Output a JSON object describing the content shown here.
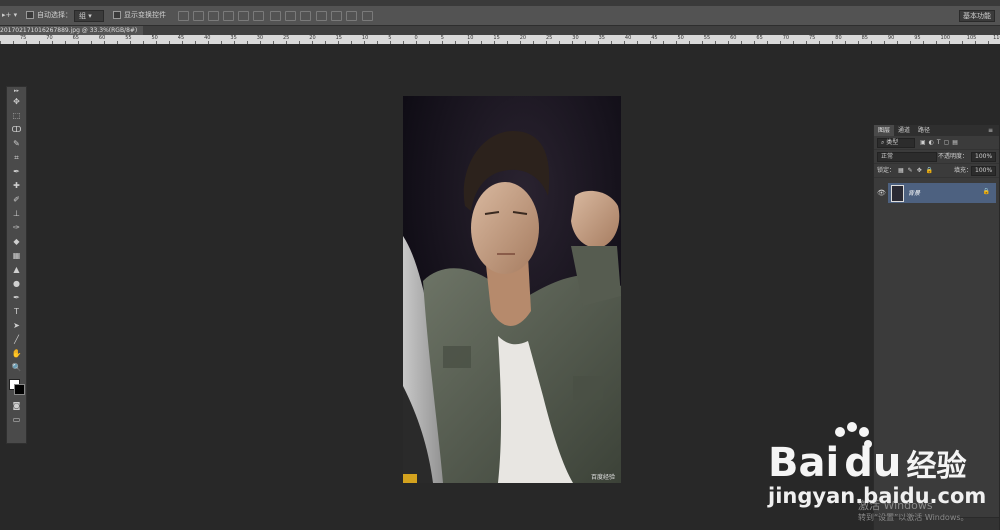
{
  "menu": {
    "items": [
      "",
      "",
      "",
      "",
      "",
      "",
      "",
      "",
      "",
      "",
      ""
    ]
  },
  "options": {
    "auto_select_label": "自动选择：",
    "auto_select_value": "组",
    "show_transform_label": "显示变换控件",
    "workspace_label": "基本功能"
  },
  "document": {
    "tab_label": "201702171016267889.jpg @ 33.3%(RGB/8#)"
  },
  "ruler": {
    "ticks": [
      "75",
      "70",
      "65",
      "60",
      "55",
      "50",
      "45",
      "40",
      "35",
      "30",
      "25",
      "20",
      "15",
      "10",
      "5",
      "0",
      "5",
      "10",
      "15",
      "20",
      "25",
      "30",
      "35",
      "40",
      "45",
      "50",
      "55",
      "60",
      "65",
      "70",
      "75",
      "80",
      "85",
      "90",
      "95",
      "100",
      "105",
      "110"
    ]
  },
  "tools": [
    "move-tool",
    "marquee-tool",
    "lasso-tool",
    "quick-select-tool",
    "crop-tool",
    "eyedropper-tool",
    "healing-tool",
    "brush-tool",
    "stamp-tool",
    "history-brush-tool",
    "eraser-tool",
    "gradient-tool",
    "blur-tool",
    "dodge-tool",
    "pen-tool",
    "type-tool",
    "path-select-tool",
    "shape-tool",
    "hand-tool",
    "zoom-tool"
  ],
  "tool_glyphs": [
    "✥",
    "⬚",
    "ↀ",
    "✎",
    "⌗",
    "✒",
    "✚",
    "✐",
    "⊥",
    "✑",
    "◆",
    "▦",
    "▲",
    "●",
    "✒",
    "T",
    "➤",
    "╱",
    "✋",
    "🔍"
  ],
  "layers_panel": {
    "tabs": [
      "图层",
      "通道",
      "路径"
    ],
    "filter_kind": "类型",
    "blend_mode": "正常",
    "opacity_label": "不透明度：",
    "opacity_value": "100%",
    "lock_label": "锁定：",
    "fill_label": "填充：",
    "fill_value": "100%",
    "layer_name": "背景"
  },
  "canvas_watermark": "百度经验",
  "windows_notice": {
    "line1": "激活 Windows",
    "line2": "转到“设置”以激活 Windows。"
  },
  "baidu": {
    "brand": "Bai",
    "brand2": "du",
    "jingyan": "经验",
    "url": "jingyan.baidu.com"
  },
  "colors": {
    "accent": "#4d6180",
    "baidu_blue": "#2932e1"
  }
}
